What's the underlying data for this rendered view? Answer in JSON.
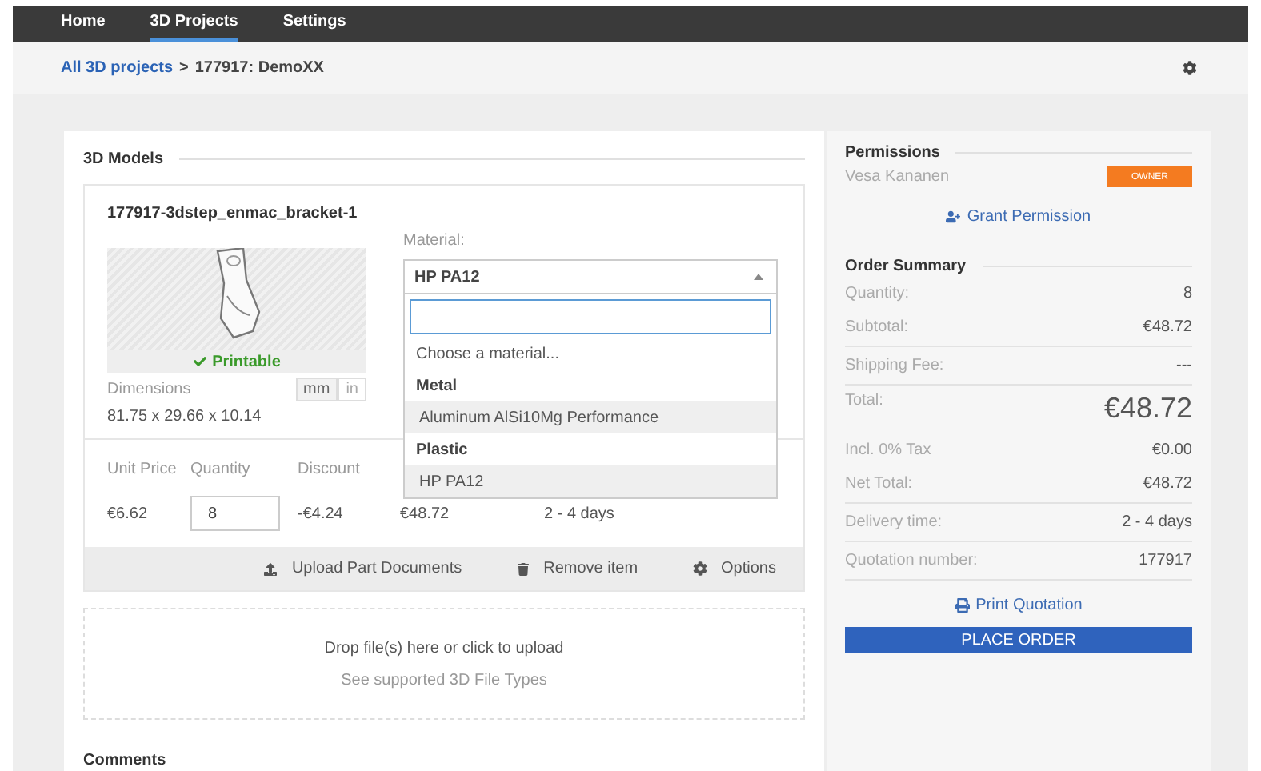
{
  "nav": {
    "tabs": [
      {
        "label": "Home",
        "selected": false
      },
      {
        "label": "3D Projects",
        "selected": true
      },
      {
        "label": "Settings",
        "selected": false
      }
    ]
  },
  "breadcrumb": {
    "link": "All 3D projects",
    "separator": ">",
    "current": "177917: DemoXX"
  },
  "models": {
    "title": "3D Models",
    "item": {
      "name": "177917-3dstep_enmac_bracket-1",
      "status": "Printable",
      "dimensions_label": "Dimensions",
      "units": [
        {
          "label": "mm",
          "selected": true
        },
        {
          "label": "in",
          "selected": false
        }
      ],
      "dimensions": "81.75 x 29.66 x 10.14",
      "material_label": "Material:",
      "material_value": "HP PA12",
      "dropdown": {
        "expanded": true,
        "options": [
          {
            "kind": "placeholder",
            "label": "Choose a material...",
            "highlighted": false
          },
          {
            "kind": "group",
            "label": "Metal",
            "highlighted": false
          },
          {
            "kind": "option",
            "label": "Aluminum AlSi10Mg Performance",
            "highlighted": true
          },
          {
            "kind": "group",
            "label": "Plastic",
            "highlighted": false
          },
          {
            "kind": "option",
            "label": "HP PA12",
            "highlighted": true
          }
        ]
      },
      "price_headers": [
        "Unit Price",
        "Quantity",
        "Discount"
      ],
      "unit_price": "€6.62",
      "quantity": "8",
      "discount": "-€4.24",
      "total": "€48.72",
      "delivery": "2 - 4 days",
      "actions": [
        {
          "kind": "upload",
          "label": "Upload Part Documents"
        },
        {
          "kind": "trash",
          "label": "Remove item"
        },
        {
          "kind": "gear",
          "label": "Options"
        }
      ]
    },
    "dropzone": {
      "text": "Drop file(s) here or click to upload",
      "link": "See supported 3D File Types"
    },
    "comments_title": "Comments"
  },
  "permissions": {
    "title": "Permissions",
    "user": "Vesa Kananen",
    "role": "OWNER",
    "grant": "Grant Permission"
  },
  "summary": {
    "title": "Order Summary",
    "groups": [
      [
        {
          "label": "Quantity:",
          "value": "8",
          "kind": "normal"
        },
        {
          "label": "Subtotal:",
          "value": "€48.72",
          "kind": "normal"
        }
      ],
      [
        {
          "label": "Shipping Fee:",
          "value": "---",
          "kind": "normal"
        }
      ],
      [
        {
          "label": "Total:",
          "value": "€48.72",
          "kind": "large"
        },
        {
          "label": "Incl. 0% Tax",
          "value": "€0.00",
          "kind": "normal"
        },
        {
          "label": "Net Total:",
          "value": "€48.72",
          "kind": "normal"
        }
      ],
      [
        {
          "label": "Delivery time:",
          "value": "2 - 4 days",
          "kind": "normal"
        }
      ],
      [
        {
          "label": "Quotation number:",
          "value": "177917",
          "kind": "normal"
        }
      ]
    ],
    "print": "Print Quotation",
    "order": "PLACE ORDER"
  }
}
